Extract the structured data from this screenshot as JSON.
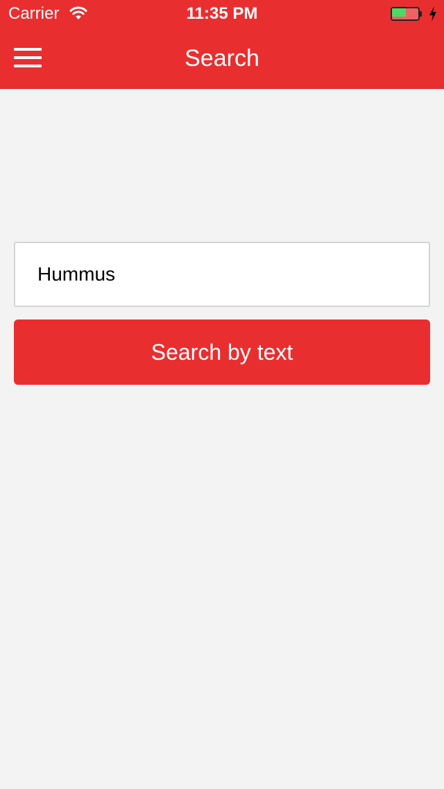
{
  "status_bar": {
    "carrier": "Carrier",
    "time": "11:35 PM",
    "battery_level": 0.6,
    "battery_color": "#4cd964",
    "charging": true,
    "icons": [
      "wifi-icon",
      "battery-icon",
      "charging-bolt-icon"
    ]
  },
  "header": {
    "title": "Search",
    "menu_icon": "hamburger-menu-icon",
    "background_color": "#e92e30"
  },
  "search": {
    "value": "Hummus",
    "button_label": "Search by text",
    "button_color": "#e92e30"
  },
  "page": {
    "background_color": "#f3f3f3"
  }
}
